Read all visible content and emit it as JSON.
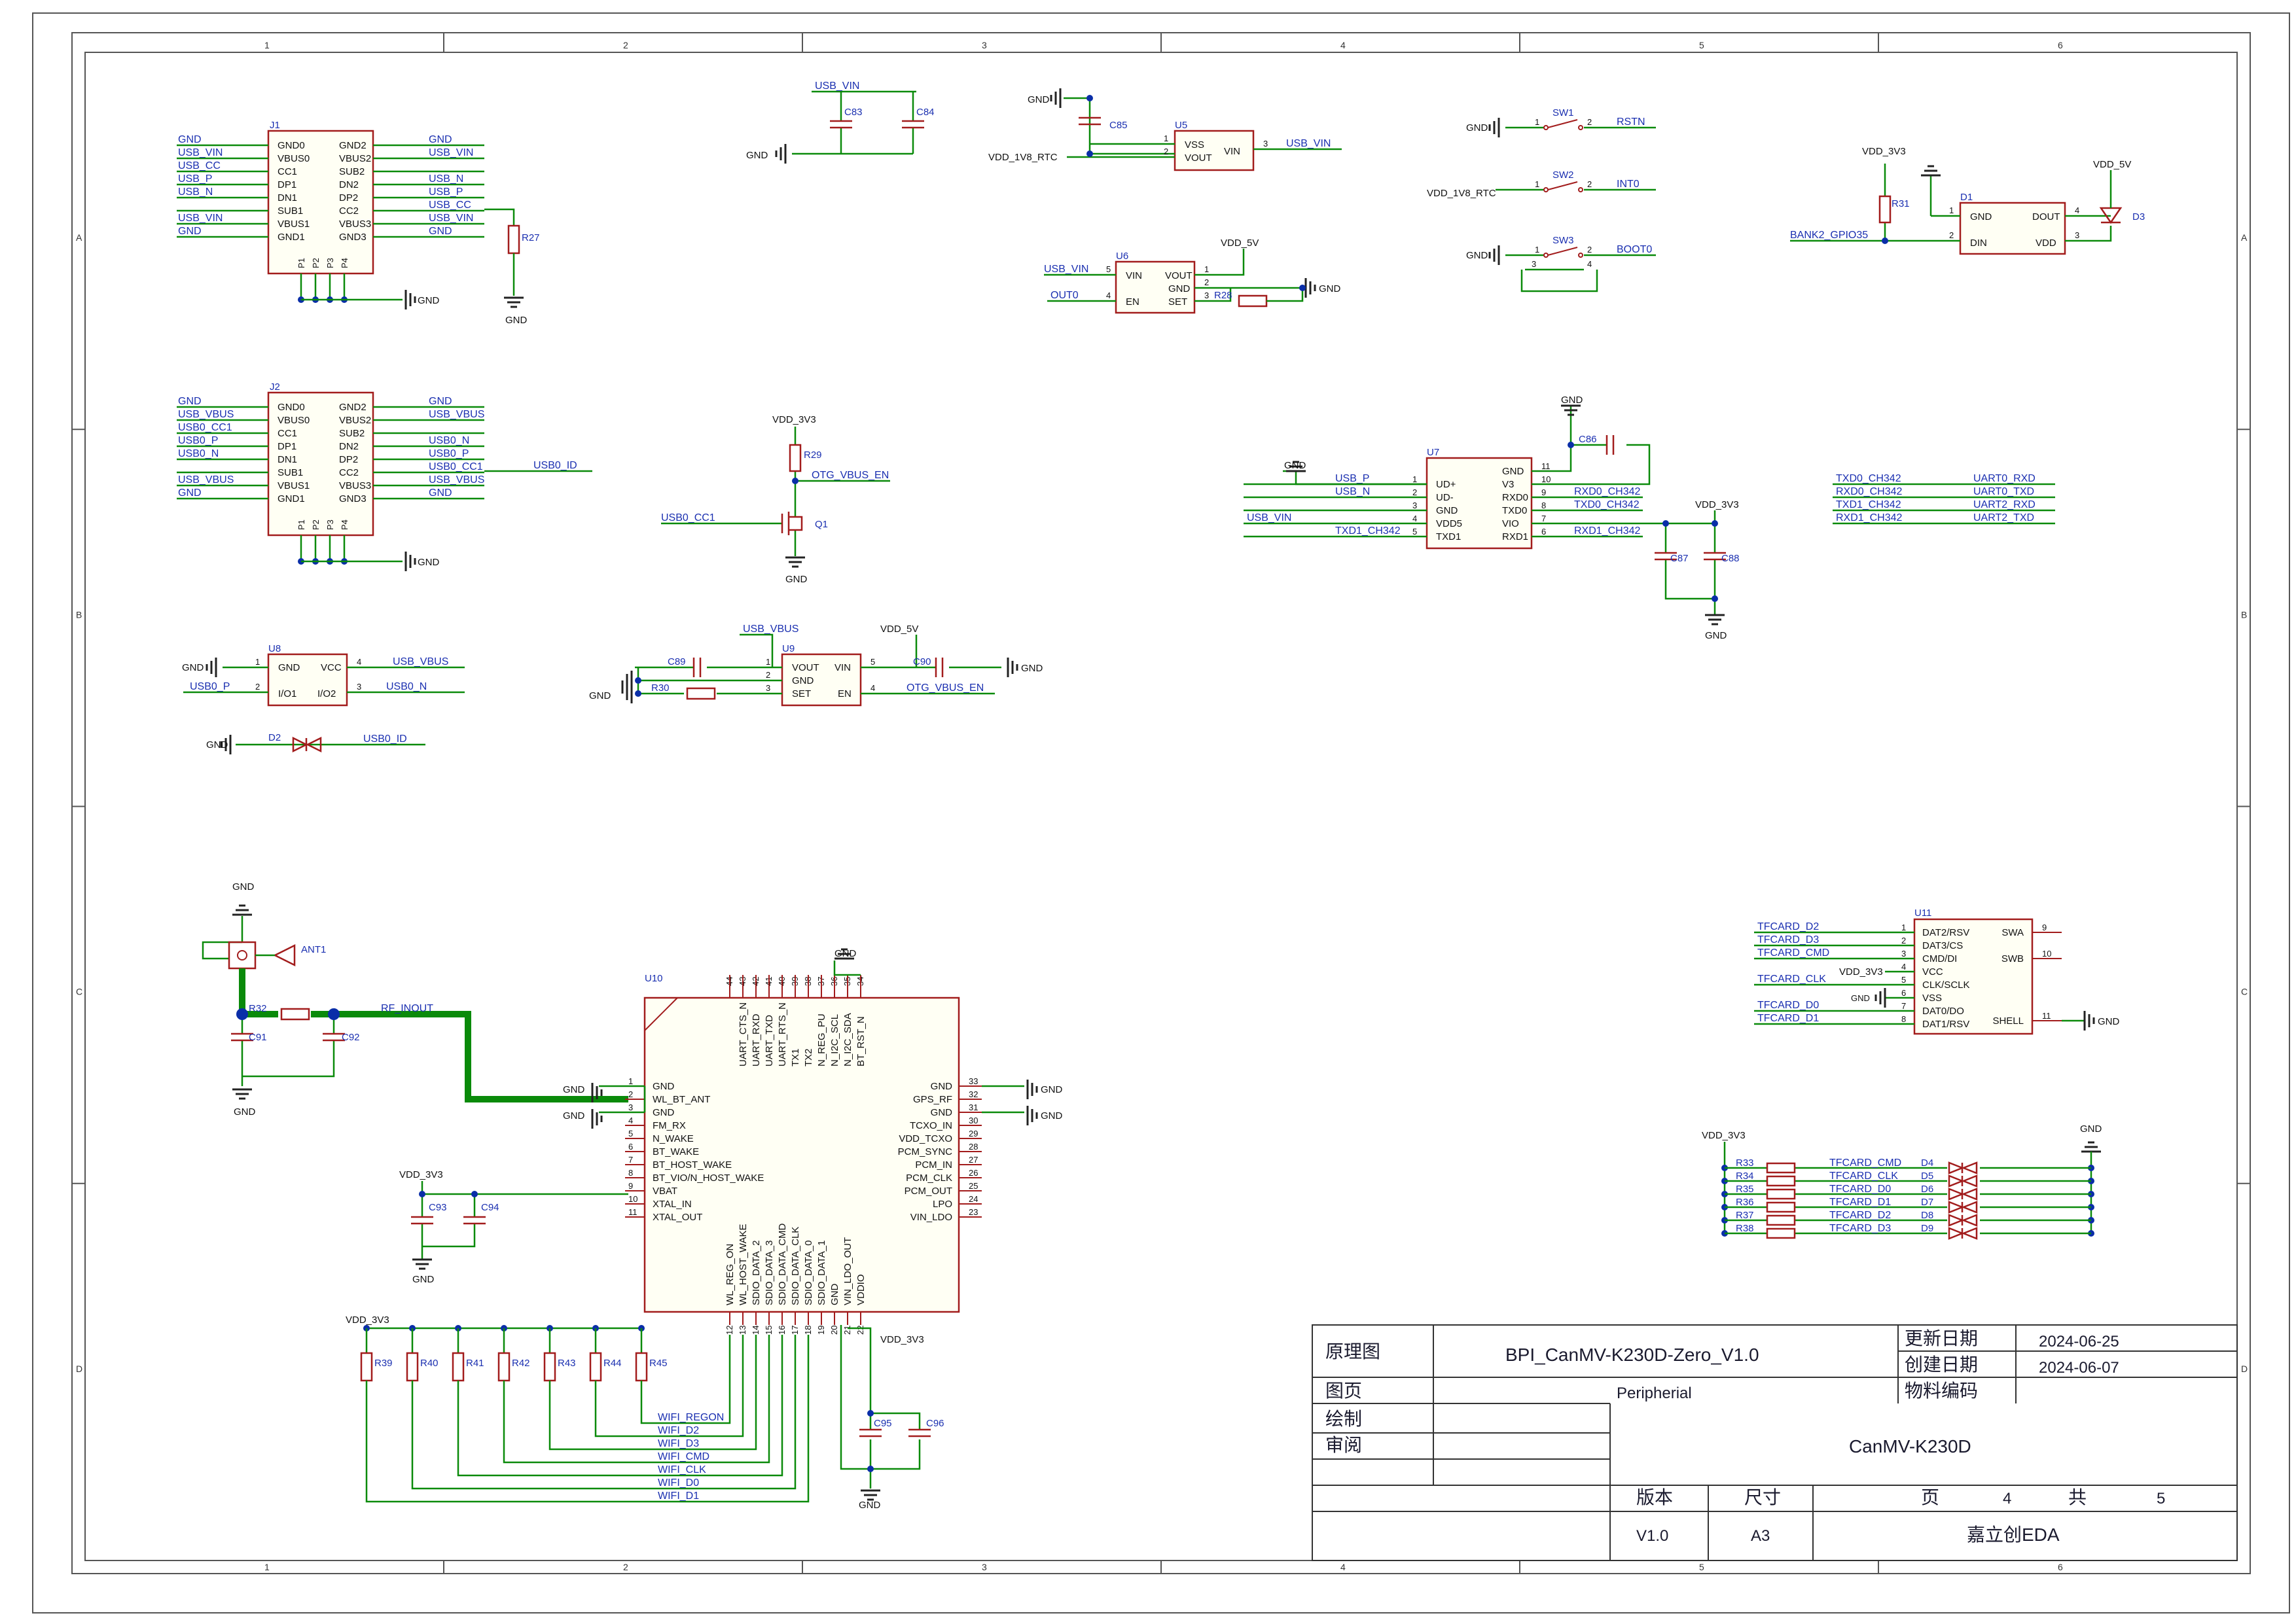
{
  "sheet": {
    "columns": [
      "1",
      "2",
      "3",
      "4",
      "5",
      "6"
    ],
    "rows": [
      "A",
      "B",
      "C",
      "D"
    ]
  },
  "title_block": {
    "schematic_label": "原理图",
    "project": "BPI_CanMV-K230D-Zero_V1.0",
    "update_date_label": "更新日期",
    "update_date": "2024-06-25",
    "create_date_label": "创建日期",
    "create_date": "2024-06-07",
    "page_label": "图页",
    "page_name": "Peripherial",
    "material_label": "物料编码",
    "draw_label": "绘制",
    "review_label": "审阅",
    "board": "CanMV-K230D",
    "version_label": "版本",
    "size_label": "尺寸",
    "page_word": "页",
    "total_word": "共",
    "version": "V1.0",
    "size": "A3",
    "page_num": "4",
    "page_total": "5",
    "tool": "嘉立创EDA"
  },
  "components": {
    "J1": {
      "ref": "J1",
      "left_pins": [
        "GND0",
        "VBUS0",
        "CC1",
        "DP1",
        "DN1",
        "SUB1",
        "VBUS1",
        "GND1"
      ],
      "right_pins": [
        "GND2",
        "VBUS2",
        "SUB2",
        "DN2",
        "DP2",
        "CC2",
        "VBUS3",
        "GND3"
      ],
      "bottom_pins": [
        "P1",
        "P2",
        "P3",
        "P4"
      ],
      "left_nets": [
        "GND",
        "USB_VIN",
        "USB_CC",
        "USB_P",
        "USB_N",
        "",
        "USB_VIN",
        "GND"
      ],
      "right_nets": [
        "GND",
        "USB_VIN",
        "",
        "USB_N",
        "USB_P",
        "USB_CC",
        "USB_VIN",
        "GND"
      ]
    },
    "J2": {
      "ref": "J2",
      "left_pins": [
        "GND0",
        "VBUS0",
        "CC1",
        "DP1",
        "DN1",
        "SUB1",
        "VBUS1",
        "GND1"
      ],
      "right_pins": [
        "GND2",
        "VBUS2",
        "SUB2",
        "DN2",
        "DP2",
        "CC2",
        "VBUS3",
        "GND3"
      ],
      "bottom_pins": [
        "P1",
        "P2",
        "P3",
        "P4"
      ],
      "left_nets": [
        "GND",
        "USB_VBUS",
        "USB0_CC1",
        "USB0_P",
        "USB0_N",
        "",
        "USB_VBUS",
        "GND"
      ],
      "right_nets": [
        "GND",
        "USB_VBUS",
        "",
        "USB0_N",
        "USB0_P",
        "USB0_CC1",
        "USB_VBUS",
        "GND"
      ],
      "extra_net": "USB0_ID"
    },
    "U5": {
      "ref": "U5",
      "pins": [
        "VSS",
        "VOUT",
        "VIN"
      ],
      "nums": [
        "1",
        "2",
        "3"
      ],
      "net_in": "USB_VIN",
      "net_out": "VDD_1V8_RTC"
    },
    "U6": {
      "ref": "U6",
      "pins": [
        "VIN",
        "EN",
        "VOUT",
        "GND",
        "SET"
      ],
      "nums": [
        "5",
        "4",
        "1",
        "2",
        "3"
      ],
      "net_in": "USB_VIN",
      "net_en": "OUT0",
      "net_out": "VDD_5V"
    },
    "U7": {
      "ref": "U7",
      "left_pins": [
        "UD+",
        "UD-",
        "GND",
        "VDD5",
        "TXD1"
      ],
      "left_nums": [
        "1",
        "2",
        "3",
        "4",
        "5"
      ],
      "right_pins": [
        "GND",
        "V3",
        "RXD0",
        "TXD0",
        "VIO",
        "RXD1"
      ],
      "right_nums": [
        "11",
        "10",
        "9",
        "8",
        "7",
        "6"
      ],
      "left_nets": [
        "USB_P",
        "USB_N",
        "",
        "USB_VIN",
        "TXD1_CH342"
      ],
      "right_nets": [
        "",
        "",
        "RXD0_CH342",
        "TXD0_CH342",
        "",
        "RXD1_CH342"
      ]
    },
    "U8": {
      "ref": "U8",
      "pins": [
        "GND",
        "I/O1",
        "VCC",
        "I/O2"
      ],
      "nums": [
        "1",
        "2",
        "4",
        "3"
      ],
      "nets": [
        "USB0_P",
        "USB_VBUS",
        "USB0_N"
      ]
    },
    "U9": {
      "ref": "U9",
      "pins": [
        "VOUT",
        "GND",
        "SET",
        "VIN",
        "EN"
      ],
      "nums": [
        "1",
        "2",
        "3",
        "5",
        "4"
      ],
      "nets": [
        "USB_VBUS",
        "VDD_5V",
        "OTG_VBUS_EN"
      ]
    },
    "U10": {
      "ref": "U10",
      "left_pins": [
        "GND",
        "WL_BT_ANT",
        "GND",
        "FM_RX",
        "N_WAKE",
        "BT_WAKE",
        "BT_HOST_WAKE",
        "BT_VIO/N_HOST_WAKE",
        "VBAT",
        "XTAL_IN",
        "XTAL_OUT"
      ],
      "left_nums": [
        "1",
        "2",
        "3",
        "4",
        "5",
        "6",
        "7",
        "8",
        "9",
        "10",
        "11"
      ],
      "right_pins": [
        "GND",
        "GPS_RF",
        "GND",
        "TCXO_IN",
        "VDD_TCXO",
        "PCM_SYNC",
        "PCM_IN",
        "PCM_CLK",
        "PCM_OUT",
        "LPO",
        "VIN_LDO"
      ],
      "right_nums": [
        "33",
        "32",
        "31",
        "30",
        "29",
        "28",
        "27",
        "26",
        "25",
        "24",
        "23"
      ],
      "top_pins": [
        "UART_CTS_N",
        "UART_RXD",
        "UART_TXD",
        "UART_RTS_N",
        "TX1",
        "TX2",
        "N_REG_PU",
        "N_I2C_SCL",
        "N_I2C_SDA",
        "BT_RST_N"
      ],
      "top_nums": [
        "44",
        "43",
        "42",
        "41",
        "40",
        "39",
        "38",
        "37",
        "36",
        "35",
        "34"
      ],
      "bottom_pins": [
        "WL_REG_ON",
        "WL_HOST_WAKE",
        "SDIO_DATA_2",
        "SDIO_DATA_3",
        "SDIO_DATA_CMD",
        "SDIO_DATA_CLK",
        "SDIO_DATA_0",
        "SDIO_DATA_1",
        "GND",
        "VIN_LDO_OUT",
        "VDDIO"
      ],
      "bottom_nums": [
        "12",
        "13",
        "14",
        "15",
        "16",
        "17",
        "18",
        "19",
        "20",
        "21",
        "22"
      ]
    },
    "U11": {
      "ref": "U11",
      "left_pins": [
        "DAT2/RSV",
        "DAT3/CS",
        "CMD/DI",
        "VCC",
        "CLK/SCLK",
        "VSS",
        "DAT0/DO",
        "DAT1/RSV"
      ],
      "left_nums": [
        "1",
        "2",
        "3",
        "4",
        "5",
        "6",
        "7",
        "8"
      ],
      "right_pins": [
        "SWA",
        "SWB",
        "SHELL"
      ],
      "right_nums": [
        "9",
        "10",
        "11"
      ],
      "left_nets": [
        "TFCARD_D2",
        "TFCARD_D3",
        "TFCARD_CMD",
        "VDD_3V3",
        "TFCARD_CLK",
        "GND",
        "TFCARD_D0",
        "TFCARD_D1"
      ]
    },
    "D1": {
      "ref": "D1",
      "pins": [
        "GND",
        "DIN",
        "DOUT",
        "VDD"
      ],
      "nums": [
        "1",
        "2",
        "4",
        "3"
      ],
      "net": "BANK2_GPIO35"
    },
    "switches": [
      {
        "ref": "SW1",
        "net": "RSTN",
        "left": "GND"
      },
      {
        "ref": "SW2",
        "net": "INT0",
        "left": "VDD_1V8_RTC"
      },
      {
        "ref": "SW3",
        "net": "BOOT0",
        "left": "GND"
      }
    ],
    "uart_map": [
      {
        "left": "TXD0_CH342",
        "right": "UART0_RXD"
      },
      {
        "left": "RXD0_CH342",
        "right": "UART0_TXD"
      },
      {
        "left": "TXD1_CH342",
        "right": "UART2_RXD"
      },
      {
        "left": "RXD1_CH342",
        "right": "UART2_TXD"
      }
    ],
    "esd_rows": [
      {
        "r": "R33",
        "net": "TFCARD_CMD",
        "d": "D4"
      },
      {
        "r": "R34",
        "net": "TFCARD_CLK",
        "d": "D5"
      },
      {
        "r": "R35",
        "net": "TFCARD_D0",
        "d": "D6"
      },
      {
        "r": "R36",
        "net": "TFCARD_D1",
        "d": "D7"
      },
      {
        "r": "R37",
        "net": "TFCARD_D2",
        "d": "D8"
      },
      {
        "r": "R38",
        "net": "TFCARD_D3",
        "d": "D9"
      }
    ],
    "pullups": [
      "R39",
      "R40",
      "R41",
      "R42",
      "R43",
      "R44",
      "R45"
    ],
    "wifi_nets": [
      "WIFI_REGON",
      "WIFI_D2",
      "WIFI_D3",
      "WIFI_CMD",
      "WIFI_CLK",
      "WIFI_D0",
      "WIFI_D1"
    ]
  },
  "labels": {
    "gnd": "GND",
    "vdd3v3": "VDD_3V3",
    "vdd5v": "VDD_5V",
    "vdd1v8": "VDD_1V8_RTC",
    "usb_vin": "USB_VIN",
    "usb_vbus": "USB_VBUS",
    "usb0_cc1": "USB0_CC1",
    "otg_en": "OTG_VBUS_EN",
    "usb0_id": "USB0_ID",
    "out0": "OUT0",
    "rf_inout": "RF_INOUT",
    "ant": "ANT1",
    "r27": "R27",
    "r28": "R28",
    "r29": "R29",
    "r30": "R30",
    "r31": "R31",
    "r32": "R32",
    "q1": "Q1",
    "d2": "D2",
    "d3": "D3",
    "c83": "C83",
    "c84": "C84",
    "c85": "C85",
    "c86": "C86",
    "c87": "C87",
    "c88": "C88",
    "c89": "C89",
    "c90": "C90",
    "c91": "C91",
    "c92": "C92",
    "c93": "C93",
    "c94": "C94",
    "c95": "C95",
    "c96": "C96"
  }
}
